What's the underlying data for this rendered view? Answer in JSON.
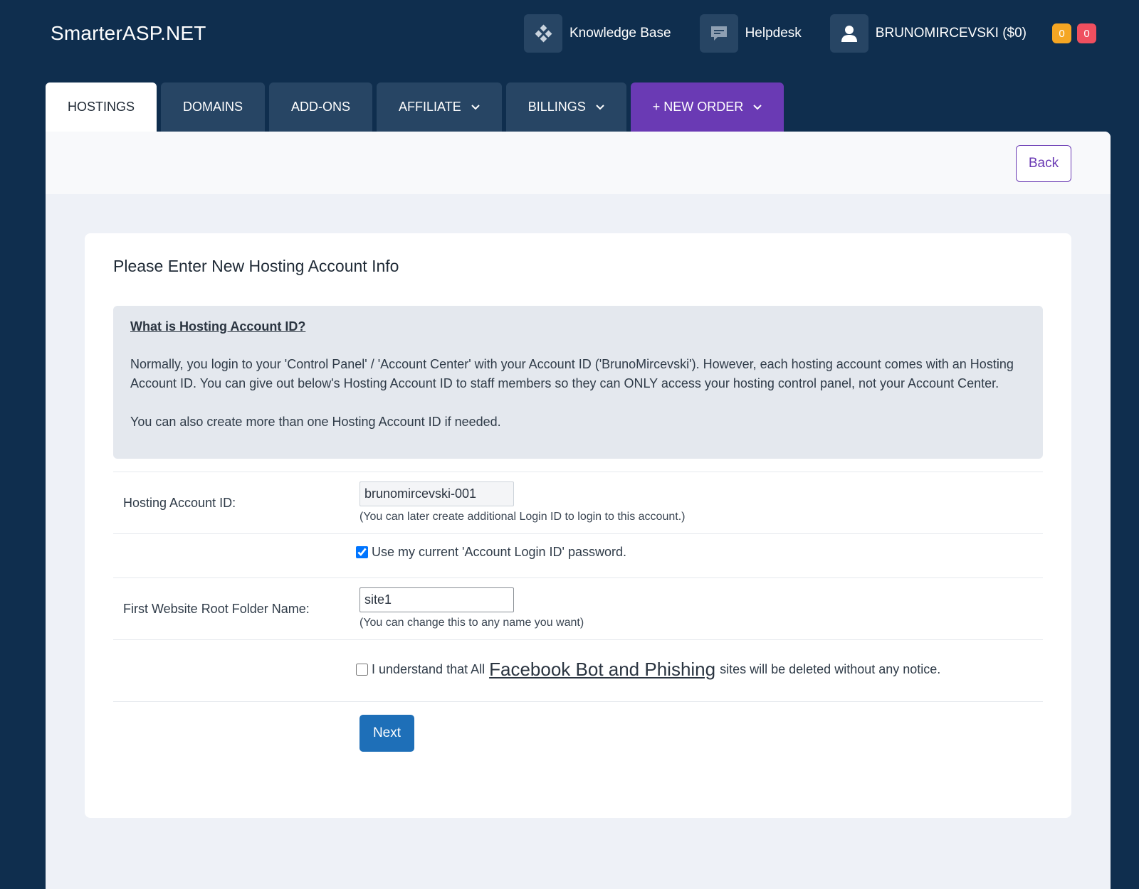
{
  "header": {
    "logo": "SmarterASP.NET",
    "nav": {
      "knowledge_base": "Knowledge Base",
      "helpdesk": "Helpdesk",
      "account": "BRUNOMIRCEVSKI ($0)"
    },
    "badges": {
      "orange": "0",
      "red": "0"
    }
  },
  "tabs": [
    {
      "label": "HOSTINGS"
    },
    {
      "label": "DOMAINS"
    },
    {
      "label": "ADD-ONS"
    },
    {
      "label": "AFFILIATE"
    },
    {
      "label": "BILLINGS"
    },
    {
      "label": "+ NEW ORDER"
    }
  ],
  "panel": {
    "back_label": "Back"
  },
  "form": {
    "title": "Please Enter New Hosting Account Info",
    "info_heading": "What is Hosting Account ID?",
    "info_paragraph_1": "Normally, you login to your 'Control Panel' / 'Account Center' with your Account ID ('BrunoMircevski'). However, each hosting account comes with an Hosting Account ID. You can give out below's Hosting Account ID to staff members so they can ONLY access your hosting control panel, not your Account Center.",
    "info_paragraph_2": "You can also create more than one Hosting Account ID if needed.",
    "hosting_id_label": "Hosting Account ID:",
    "hosting_id_value": "brunomircevski-001",
    "hosting_id_hint": "(You can later create additional Login ID to login to this account.)",
    "password_checkbox_label": "Use my current 'Account Login ID' password.",
    "password_checked": true,
    "root_folder_label": "First Website Root Folder Name:",
    "root_folder_value": "site1",
    "root_folder_hint": "(You can change this to any name you want)",
    "terms_prefix": "I understand that All",
    "terms_link": "Facebook Bot and Phishing",
    "terms_suffix": "sites will be deleted without any notice.",
    "terms_checked": false,
    "next_label": "Next"
  },
  "colors": {
    "background": "#0f2e4e",
    "tab": "#274564",
    "new_order": "#6a3ab4",
    "next_button": "#1e6fb8",
    "badge_orange": "#f5a623",
    "badge_red": "#ef4f5f"
  }
}
